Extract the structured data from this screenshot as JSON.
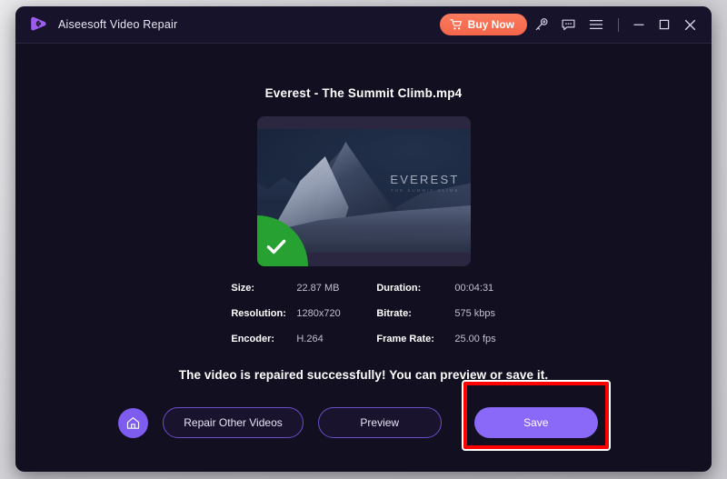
{
  "window": {
    "app_title": "Aiseesoft Video Repair",
    "logo_icon": "play-logo-icon"
  },
  "titlebar": {
    "buy_now_label": "Buy Now",
    "cart_icon": "cart-icon",
    "key_icon": "key-icon",
    "feedback_icon": "feedback-icon",
    "menu_icon": "hamburger-menu-icon",
    "minimize_icon": "minimize-icon",
    "maximize_icon": "maximize-icon",
    "close_icon": "close-icon"
  },
  "main": {
    "file_title": "Everest - The Summit Climb.mp4",
    "thumbnail": {
      "overlay_title": "EVEREST",
      "overlay_subtitle": "THE SUMMIT CLIMB",
      "badge_icon": "check-icon"
    },
    "meta": [
      {
        "label": "Size:",
        "value": "22.87 MB"
      },
      {
        "label": "Duration:",
        "value": "00:04:31"
      },
      {
        "label": "Resolution:",
        "value": "1280x720"
      },
      {
        "label": "Bitrate:",
        "value": "575 kbps"
      },
      {
        "label": "Encoder:",
        "value": "H.264"
      },
      {
        "label": "Frame Rate:",
        "value": "25.00 fps"
      }
    ],
    "status_message": "The video is repaired successfully! You can preview or save it.",
    "actions": {
      "home_icon": "home-icon",
      "repair_other_label": "Repair Other Videos",
      "preview_label": "Preview",
      "save_label": "Save"
    }
  },
  "colors": {
    "accent_purple": "#8a68f8",
    "buy_now_orange": "#f5654a",
    "success_green": "#27a232",
    "highlight_red": "#fe0000",
    "window_background": "#120f20",
    "titlebar_background": "#17132a"
  }
}
